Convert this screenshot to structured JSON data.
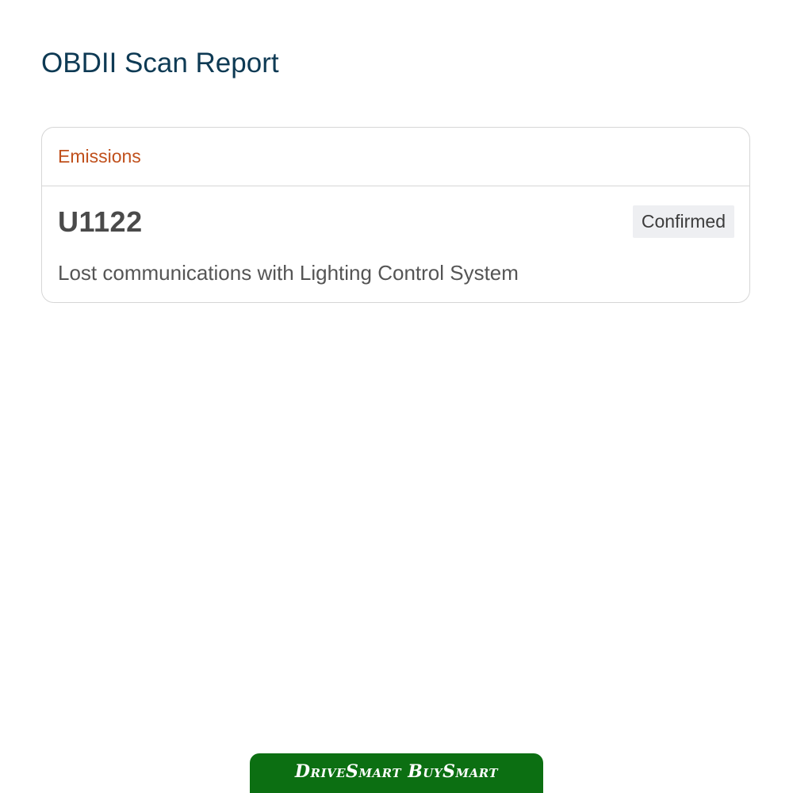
{
  "page": {
    "title": "OBDII Scan Report"
  },
  "report": {
    "section_label": "Emissions",
    "code": "U1122",
    "status": "Confirmed",
    "description": "Lost communications with Lighting Control System"
  },
  "footer": {
    "logo_text": "DriveSmart BuySmart",
    "background_color": "#0c6f12"
  },
  "colors": {
    "title": "#0e3a54",
    "section_label": "#c0501c"
  }
}
